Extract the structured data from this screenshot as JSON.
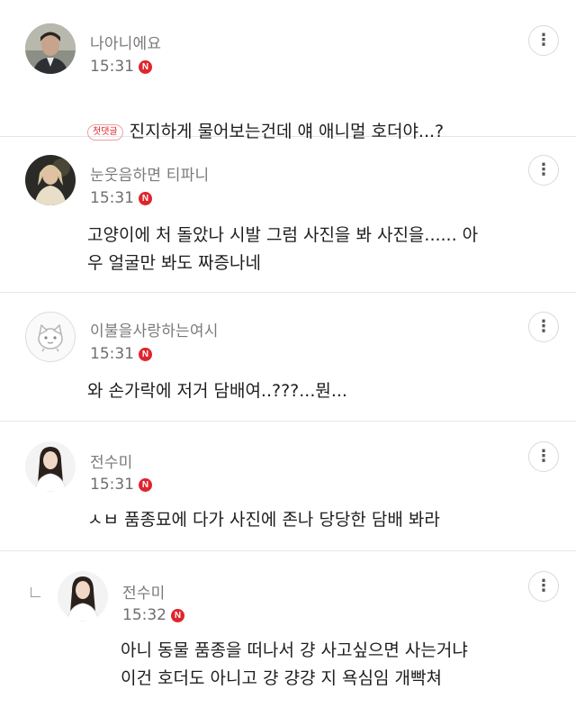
{
  "comments": [
    {
      "author": "나아니에요",
      "time": "15:31",
      "new_badge": "N",
      "first_badge": "첫댓글",
      "text": "진지하게 물어보는건데 얘 애니멀 호더야...?",
      "avatar_icon": "person-avatar-icon"
    },
    {
      "author": "눈웃음하면 티파니",
      "time": "15:31",
      "new_badge": "N",
      "text": "고양이에 처 돌았나 시발 그럼 사진을 봐 사진을...... 아\n우 얼굴만 봐도 짜증나네",
      "avatar_icon": "person-avatar-icon"
    },
    {
      "author": "이불을사랑하는여시",
      "time": "15:31",
      "new_badge": "N",
      "text": "와 손가락에 저거 담배여..???...뭔...",
      "avatar_icon": "fox-default-avatar-icon"
    },
    {
      "author": "전수미",
      "time": "15:31",
      "new_badge": "N",
      "text": "ㅅㅂ 품종묘에 다가 사진에 존나 당당한 담배 봐라",
      "avatar_icon": "person-avatar-icon"
    },
    {
      "author": "전수미",
      "time": "15:32",
      "new_badge": "N",
      "text": "아니 동물 품종을 떠나서 걍 사고싶으면 사는거냐\n이건 호더도 아니고 걍 걍걍 지 욕심임 개빡쳐",
      "avatar_icon": "person-avatar-icon",
      "is_reply": true
    }
  ],
  "more_icon": "⋮",
  "colors": {
    "new_badge": "#e0242d",
    "divider": "#e6e6e6"
  }
}
